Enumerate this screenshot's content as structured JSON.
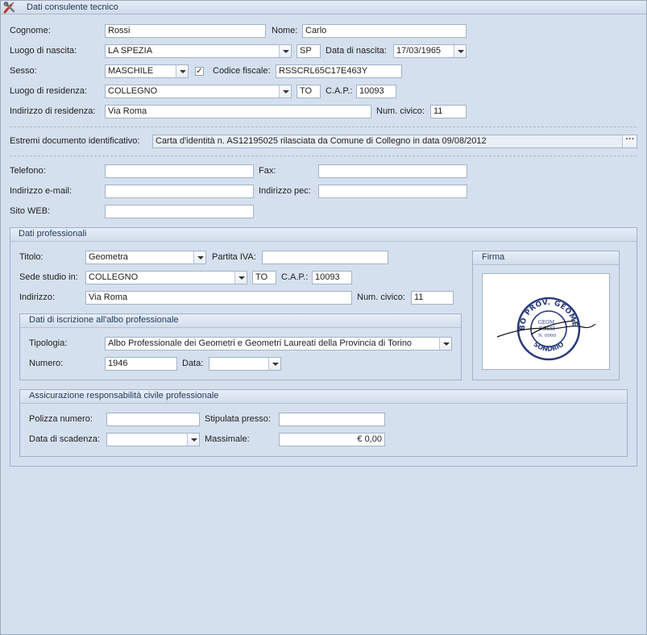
{
  "window": {
    "title": "Dati consulente tecnico"
  },
  "personal": {
    "cognome_label": "Cognome:",
    "cognome": "Rossi",
    "nome_label": "Nome:",
    "nome": "Carlo",
    "luogo_nascita_label": "Luogo di nascita:",
    "luogo_nascita": "LA SPEZIA",
    "prov_nascita": "SP",
    "data_nascita_label": "Data di nascita:",
    "data_nascita": "17/03/1965",
    "sesso_label": "Sesso:",
    "sesso": "MASCHILE",
    "codice_fiscale_label": "Codice fiscale:",
    "codice_fiscale": "RSSCRL65C17E463Y",
    "luogo_residenza_label": "Luogo di residenza:",
    "luogo_residenza": "COLLEGNO",
    "prov_residenza": "TO",
    "cap_label": "C.A.P.:",
    "cap": "10093",
    "indirizzo_label": "Indirizzo di residenza:",
    "indirizzo": "Via Roma",
    "civico_label": "Num. civico:",
    "civico": "11"
  },
  "documento": {
    "label": "Estremi documento identificativo:",
    "value": "Carta d'identità n. AS12195025 rilasciata da Comune di Collegno in data 09/08/2012",
    "button": "···"
  },
  "contatti": {
    "telefono_label": "Telefono:",
    "telefono": "",
    "fax_label": "Fax:",
    "fax": "",
    "email_label": "Indirizzo e-mail:",
    "email": "",
    "pec_label": "Indirizzo pec:",
    "pec": "",
    "web_label": "Sito WEB:",
    "web": ""
  },
  "professionali": {
    "title": "Dati professionali",
    "titolo_label": "Titolo:",
    "titolo": "Geometra",
    "piva_label": "Partita IVA:",
    "piva": "",
    "sede_label": "Sede studio in:",
    "sede": "COLLEGNO",
    "prov_sede": "TO",
    "cap_label": "C.A.P.:",
    "cap": "10093",
    "indirizzo_label": "Indirizzo:",
    "indirizzo": "Via Roma",
    "civico_label": "Num. civico:",
    "civico": "11",
    "firma_title": "Firma",
    "stamp": {
      "ring_text": "ALBO PROV. GEOMETRI",
      "bottom_text": "SONDRIO",
      "inner1": "GEOM.",
      "inner2": "ROSSI",
      "inner3": "N. 0000"
    }
  },
  "albo": {
    "title": "Dati di iscrizione all'albo professionale",
    "tipologia_label": "Tipologia:",
    "tipologia": "Albo Professionale dei Geometri e Geometri Laureati della Provincia di Torino",
    "numero_label": "Numero:",
    "numero": "1946",
    "data_label": "Data:",
    "data": ""
  },
  "assicurazione": {
    "title": "Assicurazione responsabilità civile professionale",
    "polizza_label": "Polizza numero:",
    "polizza": "",
    "stipulata_label": "Stipulata presso:",
    "stipulata": "",
    "scadenza_label": "Data di scadenza:",
    "scadenza": "",
    "massimale_label": "Massimale:",
    "massimale": "€ 0,00"
  }
}
